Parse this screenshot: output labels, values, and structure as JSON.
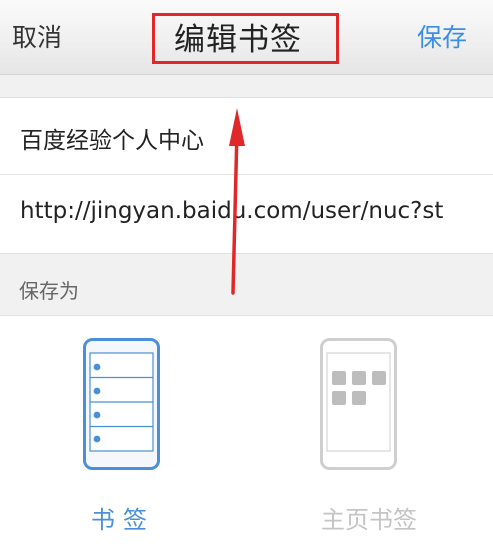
{
  "navbar": {
    "cancel_label": "取消",
    "title": "编辑书签",
    "save_label": "保存"
  },
  "form": {
    "name_value": "百度经验个人中心",
    "url_value": "http://jingyan.baidu.com/user/nuc?st"
  },
  "save_as": {
    "section_label": "保存为",
    "options": [
      {
        "label": "书签",
        "icon": "bookmark-list-icon",
        "selected": true
      },
      {
        "label": "主页书签",
        "icon": "homepage-grid-icon",
        "selected": false
      }
    ]
  },
  "colors": {
    "accent": "#3a8ee6",
    "annotation": "#e0282b",
    "inactive": "#c4c4c4"
  }
}
